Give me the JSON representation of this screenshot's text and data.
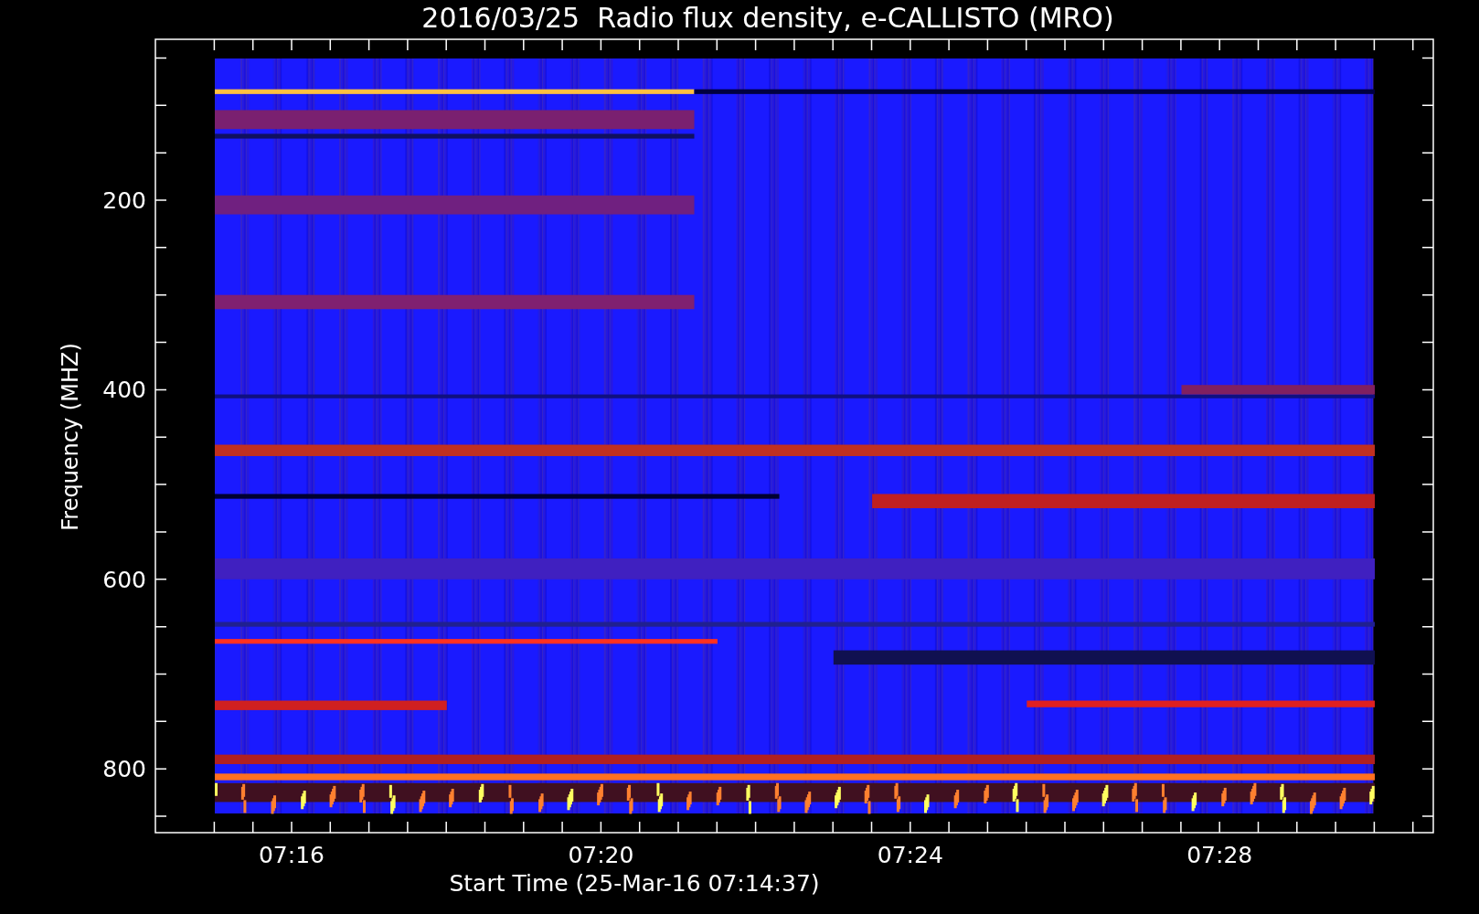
{
  "title": "2016/03/25  Radio flux density, e-CALLISTO (MRO)",
  "y_axis": {
    "label": "Frequency (MHZ)",
    "ticks": [
      "200",
      "400",
      "600",
      "800"
    ]
  },
  "x_axis": {
    "label": "Start Time (25-Mar-16 07:14:37)",
    "ticks": [
      "07:16",
      "07:20",
      "07:24",
      "07:28"
    ]
  }
}
